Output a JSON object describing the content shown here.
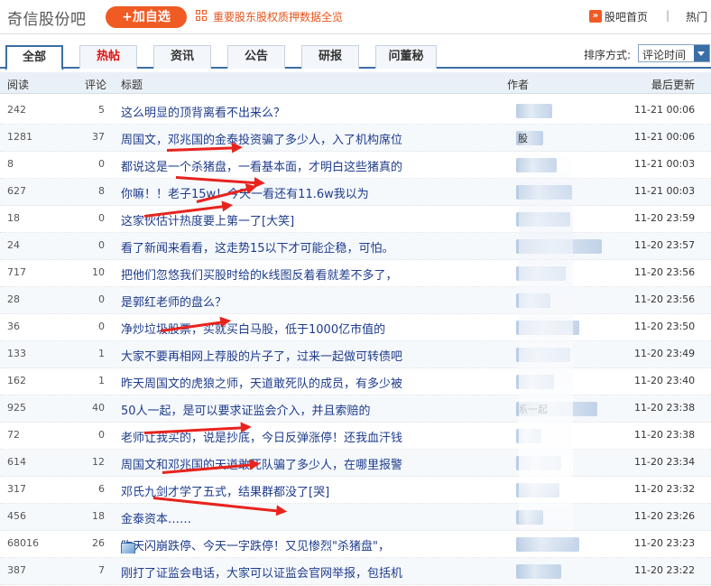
{
  "header": {
    "bar_name": "奇信股份吧",
    "add_button": "+加自选",
    "promo_link": "重要股东股权质押数据全览",
    "home_link": "股吧首页",
    "separator": "|",
    "hot_link": "热门"
  },
  "tabs": [
    {
      "label": "全部",
      "active": true
    },
    {
      "label": "热帖",
      "hot": true
    },
    {
      "label": "资讯"
    },
    {
      "label": "公告"
    },
    {
      "label": "研报"
    },
    {
      "label": "问董秘"
    }
  ],
  "sort": {
    "label": "排序方式:",
    "value": "评论时间"
  },
  "columns": {
    "read": "阅读",
    "reply": "评论",
    "title": "标题",
    "author": "作者",
    "updated": "最后更新"
  },
  "rows": [
    {
      "read": "242",
      "reply": "5",
      "title": "这么明显的顶背离看不出来么？",
      "time": "11-21 00:06"
    },
    {
      "read": "1281",
      "reply": "37",
      "title": "周国文，邓兆国的金泰投资骗了多少人，入了机构席位",
      "author": "股",
      "time": "11-21 00:06"
    },
    {
      "read": "8",
      "reply": "0",
      "title": "都说这是一个杀猪盘，一看基本面，才明白这些猪真的",
      "time": "11-21 00:03"
    },
    {
      "read": "627",
      "reply": "8",
      "title": "你嘛！！老子15w！今天一看还有11.6w我以为",
      "time": "11-21 00:03"
    },
    {
      "read": "18",
      "reply": "0",
      "title": "这家伙估计热度要上第一了[大笑]",
      "time": "11-20 23:59"
    },
    {
      "read": "24",
      "reply": "0",
      "title": "看了新闻来看看，这走势15以下才可能企稳，可怕。",
      "time": "11-20 23:57"
    },
    {
      "read": "717",
      "reply": "10",
      "title": "把他们忽悠我们买股时给的k线图反着看就差不多了，",
      "time": "11-20 23:56"
    },
    {
      "read": "28",
      "reply": "0",
      "title": "是郭红老师的盘么？",
      "time": "11-20 23:56"
    },
    {
      "read": "36",
      "reply": "0",
      "title": "净炒垃圾股票，买就买白马股，低于1000亿市值的",
      "time": "11-20 23:50"
    },
    {
      "read": "133",
      "reply": "1",
      "title": "大家不要再相网上荐股的片子了，过来一起做可转债吧",
      "time": "11-20 23:49"
    },
    {
      "read": "162",
      "reply": "1",
      "title": "昨天周国文的虎狼之师，天道敢死队的成员，有多少被",
      "time": "11-20 23:40"
    },
    {
      "read": "925",
      "reply": "40",
      "title": "50人一起，是可以要求证监会介入，并且索赔的",
      "author": "系一起",
      "time": "11-20 23:38"
    },
    {
      "read": "72",
      "reply": "0",
      "title": "老师让我买的，说是抄底，今日反弹涨停！还我血汗钱",
      "time": "11-20 23:38"
    },
    {
      "read": "614",
      "reply": "12",
      "title": "周国文和邓兆国的天道敢死队骗了多少人，在哪里报警",
      "time": "11-20 23:34"
    },
    {
      "read": "317",
      "reply": "6",
      "title": "邓氏九剑才学了五式，结果群都没了[哭]",
      "time": "11-20 23:32"
    },
    {
      "read": "456",
      "reply": "18",
      "title": "金泰资本……",
      "time": "11-20 23:26"
    },
    {
      "read": "68016",
      "reply": "26",
      "title": "昨天闪崩跌停、今天一字跌停！又见惨烈\"杀猪盘\"，",
      "image": true,
      "time": "11-20 23:23"
    },
    {
      "read": "387",
      "reply": "7",
      "title": "刚打了证监会电话，大家可以证监会官网举报，包括机",
      "time": "11-20 23:22"
    }
  ],
  "colors": {
    "accent": "#f05a23",
    "tab_border": "#3a6ea5",
    "title_link": "#1e3c8c",
    "hot": "#e01212",
    "arrow": "#e8231e"
  }
}
